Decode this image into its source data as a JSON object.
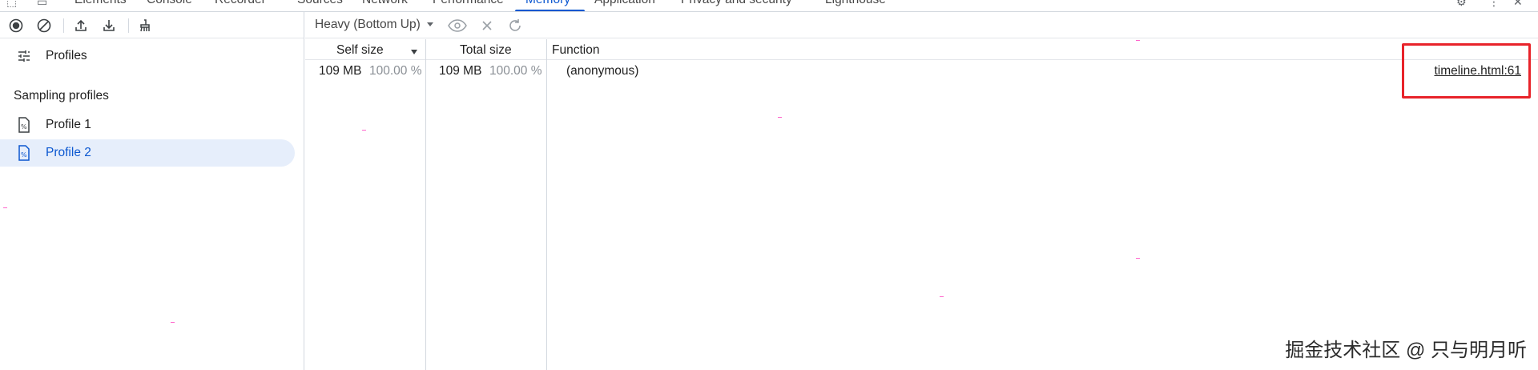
{
  "devtools_tabs": [
    "Elements",
    "Console",
    "Recorder",
    "Sources",
    "Network",
    "Performance",
    "Memory",
    "Application",
    "Privacy and security",
    "Lighthouse"
  ],
  "active_tab": "Memory",
  "sidebar": {
    "profiles_label": "Profiles",
    "section_title": "Sampling profiles",
    "items": [
      {
        "label": "Profile 1",
        "selected": false
      },
      {
        "label": "Profile 2",
        "selected": true
      }
    ]
  },
  "toolbar": {
    "view_select": "Heavy (Bottom Up)"
  },
  "grid": {
    "headers": {
      "self_size": "Self size",
      "total_size": "Total size",
      "function": "Function"
    },
    "rows": [
      {
        "self_size": "109 MB",
        "self_pct": "100.00 %",
        "total_size": "109 MB",
        "total_pct": "100.00 %",
        "function": "(anonymous)",
        "source_link": "timeline.html:61"
      }
    ]
  },
  "watermark": "掘金技术社区 @ 只与明月听",
  "colors": {
    "accent": "#0b57d0",
    "selected_bg": "#e6eefb",
    "highlight_box": "#e8232a"
  }
}
